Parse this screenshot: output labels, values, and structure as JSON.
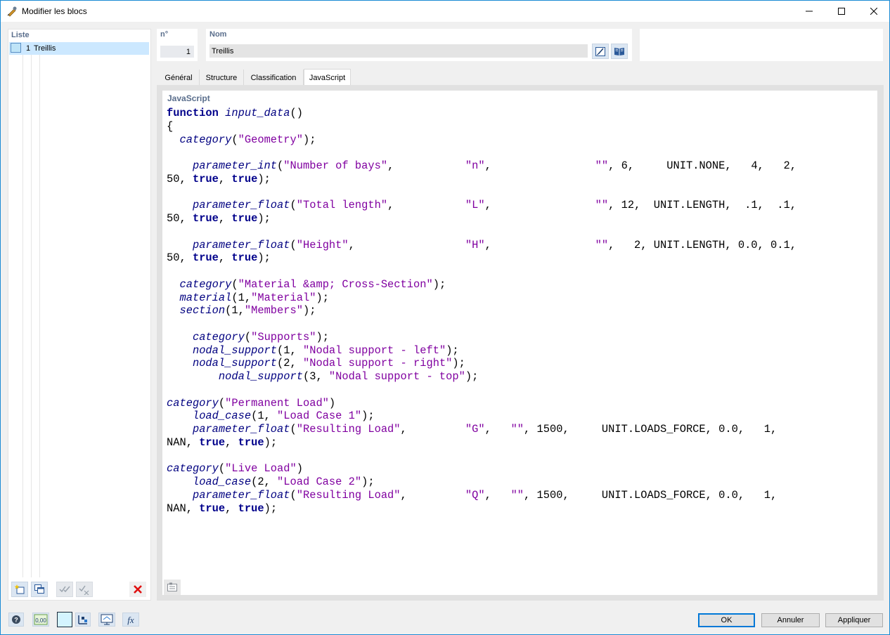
{
  "window": {
    "title": "Modifier les blocs"
  },
  "list": {
    "header": "Liste",
    "items": [
      {
        "number": "1",
        "label": "Treillis"
      }
    ]
  },
  "block": {
    "number_label": "n°",
    "number_value": "1",
    "name_label": "Nom",
    "name_value": "Treillis"
  },
  "tabs": [
    "Général",
    "Structure",
    "Classification",
    "JavaScript"
  ],
  "active_tab": "JavaScript",
  "editor": {
    "header": "JavaScript",
    "code_lines": [
      "function input_data()",
      "{",
      "  category(\"Geometry\");",
      "",
      "    parameter_int(\"Number of bays\",           \"n\",                \"\", 6,     UNIT.NONE,   4,   2,",
      "50, true, true);",
      "",
      "    parameter_float(\"Total length\",           \"L\",                \"\", 12,  UNIT.LENGTH,  .1,  .1,",
      "50, true, true);",
      "",
      "    parameter_float(\"Height\",                 \"H\",                \"\",   2, UNIT.LENGTH, 0.0, 0.1,",
      "50, true, true);",
      "",
      "  category(\"Material &amp; Cross-Section\");",
      "  material(1,\"Material\");",
      "  section(1,\"Members\");",
      "",
      "    category(\"Supports\");",
      "    nodal_support(1, \"Nodal support - left\");",
      "    nodal_support(2, \"Nodal support - right\");",
      "        nodal_support(3, \"Nodal support - top\");",
      "",
      "category(\"Permanent Load\")",
      "    load_case(1, \"Load Case 1\");",
      "    parameter_float(\"Resulting Load\",         \"G\",   \"\", 1500,     UNIT.LOADS_FORCE, 0.0,   1,",
      "NAN, true, true);",
      "",
      "category(\"Live Load\")",
      "    load_case(2, \"Load Case 2\");",
      "    parameter_float(\"Resulting Load\",         \"Q\",   \"\", 1500,     UNIT.LOADS_FORCE, 0.0,   1,",
      "NAN, true, true);"
    ]
  },
  "buttons": {
    "ok": "OK",
    "cancel": "Annuler",
    "apply": "Appliquer"
  },
  "colors": {
    "accent": "#0078d7",
    "keyword": "#00008b",
    "function": "#000080",
    "string": "#8000a0",
    "selection": "#cce8ff"
  }
}
